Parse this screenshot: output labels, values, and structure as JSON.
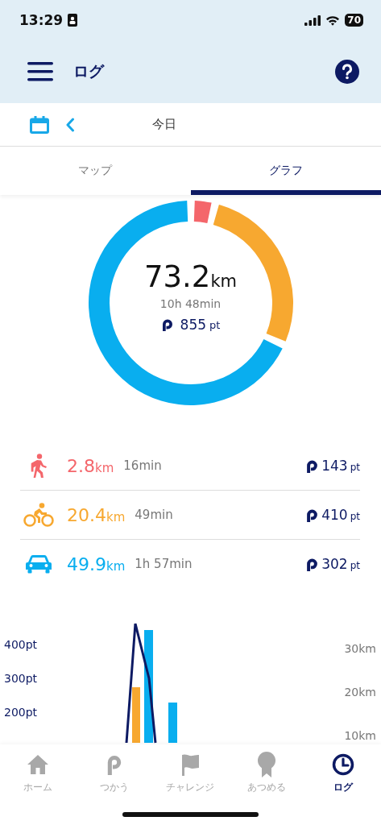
{
  "status_bar": {
    "time": "13:29",
    "battery": "70"
  },
  "header": {
    "title": "ログ"
  },
  "date_bar": {
    "label": "今日"
  },
  "tabs": [
    {
      "label": "マップ",
      "selected": false
    },
    {
      "label": "グラフ",
      "selected": true
    }
  ],
  "summary": {
    "distance": "73.2",
    "distance_unit": "km",
    "duration": "10h 48min",
    "points": "855",
    "points_unit": "pt",
    "chart_data": {
      "type": "donut",
      "values": [
        3.83,
        27.91,
        68.26
      ]
    }
  },
  "modes": [
    {
      "kind": "walk",
      "color": "#f4666b",
      "distance": "2.8",
      "unit": "km",
      "duration": "16min",
      "points": "143",
      "points_unit": "pt"
    },
    {
      "kind": "bike",
      "color": "#f7a830",
      "distance": "20.4",
      "unit": "km",
      "duration": "49min",
      "points": "410",
      "points_unit": "pt"
    },
    {
      "kind": "car",
      "color": "#09aeef",
      "distance": "49.9",
      "unit": "km",
      "duration": "1h 57min",
      "points": "302",
      "points_unit": "pt"
    }
  ],
  "trend_chart": {
    "kind": "picture",
    "points_ticks": [
      "400pt",
      "300pt",
      "200pt"
    ],
    "distance_ticks": [
      "30km",
      "20km",
      "10km"
    ]
  },
  "nav": [
    {
      "kind": "home",
      "label": "ホーム",
      "selected": false
    },
    {
      "kind": "points",
      "label": "つかう",
      "selected": false
    },
    {
      "kind": "flag",
      "label": "チャレンジ",
      "selected": false
    },
    {
      "kind": "medal",
      "label": "あつめる",
      "selected": false
    },
    {
      "kind": "clock",
      "label": "ログ",
      "selected": true
    }
  ]
}
